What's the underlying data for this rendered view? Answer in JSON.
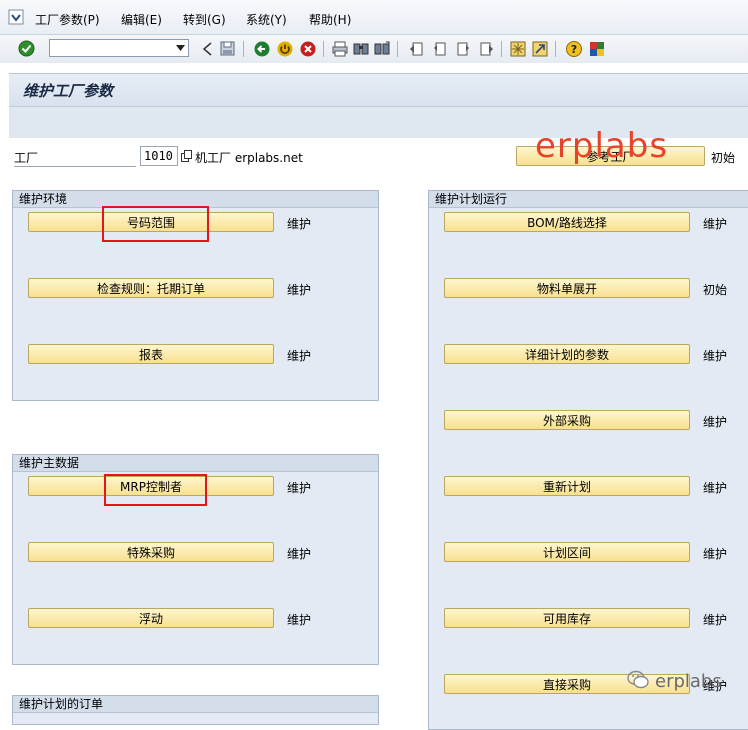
{
  "menu": {
    "items": [
      "工厂参数(P)",
      "编辑(E)",
      "转到(G)",
      "系统(Y)",
      "帮助(H)"
    ]
  },
  "page": {
    "title": "维护工厂参数"
  },
  "plant": {
    "label": "工厂",
    "value": "1010",
    "description": "机工厂 erplabs.net",
    "reference_button": "参考工厂",
    "reference_status": "初始"
  },
  "watermark": "erplabs",
  "groups": {
    "env": {
      "title": "维护环境",
      "buttons": [
        {
          "label": "号码范围",
          "status": "维护"
        },
        {
          "label": "检查规则：托期订单",
          "status": "维护"
        },
        {
          "label": "报表",
          "status": "维护"
        }
      ]
    },
    "master": {
      "title": "维护主数据",
      "buttons": [
        {
          "label": "MRP控制者",
          "status": "维护"
        },
        {
          "label": "特殊采购",
          "status": "维护"
        },
        {
          "label": "浮动",
          "status": "维护"
        }
      ]
    },
    "bottom": {
      "title": "维护计划的订单"
    },
    "run": {
      "title": "维护计划运行",
      "buttons": [
        {
          "label": "BOM/路线选择",
          "status": "维护"
        },
        {
          "label": "物料单展开",
          "status": "初始"
        },
        {
          "label": "详细计划的参数",
          "status": "维护"
        },
        {
          "label": "外部采购",
          "status": "维护"
        },
        {
          "label": "重新计划",
          "status": "维护"
        },
        {
          "label": "计划区间",
          "status": "维护"
        },
        {
          "label": "可用库存",
          "status": "维护"
        },
        {
          "label": "直接采购",
          "status": "维护"
        }
      ]
    }
  },
  "wechat_text": "erplabs",
  "colors": {
    "button_bg": "#f7e08f",
    "group_bg": "#e3eaf3",
    "highlight": "#e3161f",
    "watermark": "#e8432a"
  }
}
